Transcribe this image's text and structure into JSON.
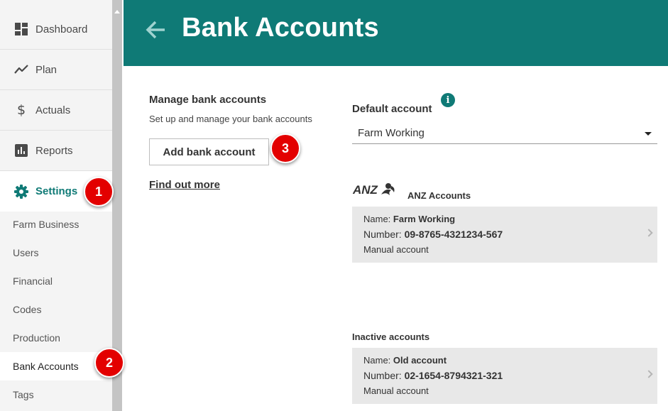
{
  "sidebar": {
    "main_items": [
      {
        "label": "Dashboard",
        "icon": "dashboard-icon"
      },
      {
        "label": "Plan",
        "icon": "trend-line-icon"
      },
      {
        "label": "Actuals",
        "icon": "dollar-icon"
      },
      {
        "label": "Reports",
        "icon": "bar-chart-icon"
      },
      {
        "label": "Settings",
        "icon": "gear-icon",
        "active": true
      }
    ],
    "sub_items": [
      {
        "label": "Farm Business"
      },
      {
        "label": "Users"
      },
      {
        "label": "Financial"
      },
      {
        "label": "Codes"
      },
      {
        "label": "Production"
      },
      {
        "label": "Bank Accounts",
        "active": true
      },
      {
        "label": "Tags"
      }
    ]
  },
  "header": {
    "title": "Bank Accounts",
    "back_icon": "arrow-left-icon"
  },
  "manage": {
    "title": "Manage bank accounts",
    "subtitle": "Set up and manage your bank accounts",
    "add_button": "Add bank account",
    "find_out_more": "Find out more"
  },
  "default_account": {
    "label": "Default account",
    "info_glyph": "i",
    "selected": "Farm Working"
  },
  "anz": {
    "logo_text": "ANZ",
    "title": "ANZ Accounts",
    "account": {
      "name_label": "Name:",
      "name": "Farm Working",
      "number_label": "Number:",
      "number": "09-8765-4321234-567",
      "type": "Manual account"
    }
  },
  "inactive": {
    "title": "Inactive accounts",
    "account": {
      "name_label": "Name:",
      "name": "Old account",
      "number_label": "Number:",
      "number": "02-1654-8794321-321",
      "type": "Manual account"
    }
  },
  "badges": [
    "1",
    "2",
    "3"
  ],
  "colors": {
    "brand": "#0f7a76",
    "badge": "#e30000",
    "sidebar_bg": "#f4f4f4",
    "card_bg": "#e8e8e8"
  }
}
